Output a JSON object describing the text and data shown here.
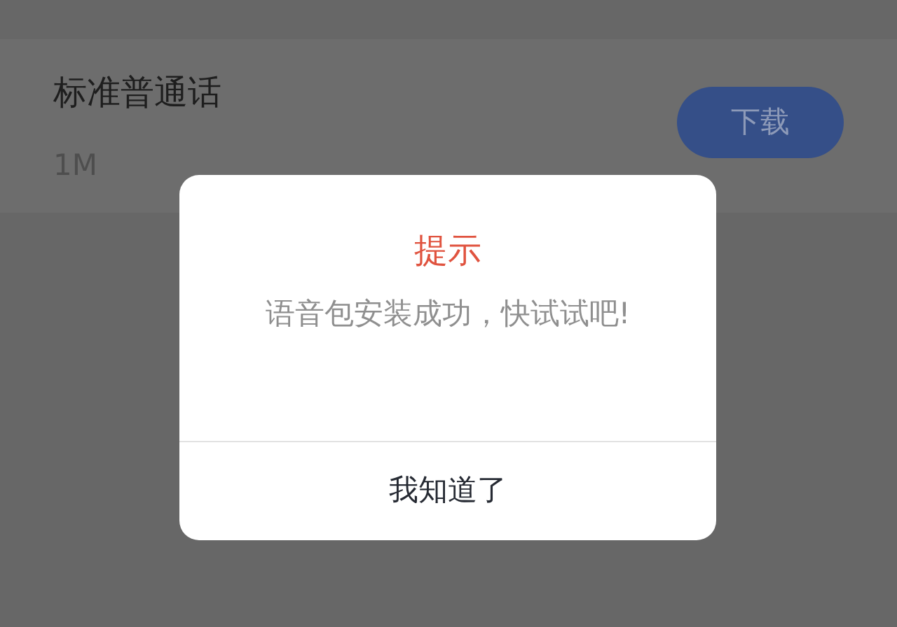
{
  "voice_pack": {
    "name": "标准普通话",
    "size": "1M",
    "download_button": "下载"
  },
  "dialog": {
    "title": "提示",
    "message": "语音包安装成功，快试试吧!",
    "button": "我知道了"
  }
}
